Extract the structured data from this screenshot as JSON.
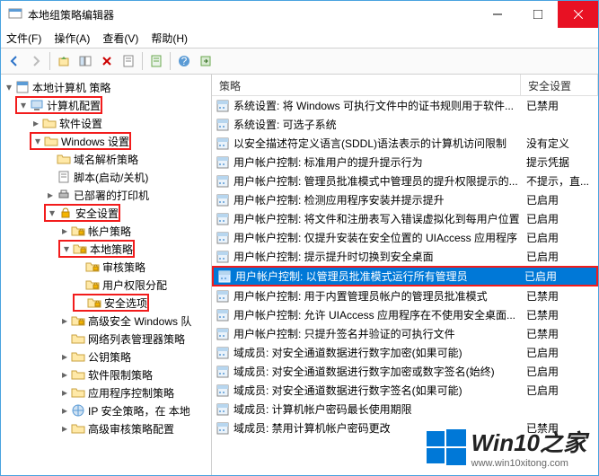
{
  "window": {
    "title": "本地组策略编辑器"
  },
  "menubar": [
    "文件(F)",
    "操作(A)",
    "查看(V)",
    "帮助(H)"
  ],
  "tree": {
    "root": "本地计算机 策略",
    "nodes": [
      {
        "indent": 0,
        "arrow": "▾",
        "label": "计算机配置",
        "hl": true,
        "icon": "computer"
      },
      {
        "indent": 1,
        "arrow": "▸",
        "label": "软件设置",
        "icon": "folder"
      },
      {
        "indent": 1,
        "arrow": "▾",
        "label": "Windows 设置",
        "hl": true,
        "icon": "folder"
      },
      {
        "indent": 2,
        "arrow": "",
        "label": "域名解析策略",
        "icon": "folder"
      },
      {
        "indent": 2,
        "arrow": "",
        "label": "脚本(启动/关机)",
        "icon": "script"
      },
      {
        "indent": 2,
        "arrow": "▸",
        "label": "已部署的打印机",
        "icon": "printer"
      },
      {
        "indent": 2,
        "arrow": "▾",
        "label": "安全设置",
        "hl": true,
        "icon": "lock"
      },
      {
        "indent": 3,
        "arrow": "▸",
        "label": "帐户策略",
        "icon": "folder-lock"
      },
      {
        "indent": 3,
        "arrow": "▾",
        "label": "本地策略",
        "hl": true,
        "icon": "folder-lock"
      },
      {
        "indent": 4,
        "arrow": "",
        "label": "审核策略",
        "icon": "folder-lock"
      },
      {
        "indent": 4,
        "arrow": "",
        "label": "用户权限分配",
        "icon": "folder-lock"
      },
      {
        "indent": 4,
        "arrow": "",
        "label": "安全选项",
        "hl": true,
        "icon": "folder-lock"
      },
      {
        "indent": 3,
        "arrow": "▸",
        "label": "高级安全 Windows 队",
        "icon": "folder-lock"
      },
      {
        "indent": 3,
        "arrow": "",
        "label": "网络列表管理器策略",
        "icon": "folder"
      },
      {
        "indent": 3,
        "arrow": "▸",
        "label": "公钥策略",
        "icon": "folder"
      },
      {
        "indent": 3,
        "arrow": "▸",
        "label": "软件限制策略",
        "icon": "folder"
      },
      {
        "indent": 3,
        "arrow": "▸",
        "label": "应用程序控制策略",
        "icon": "folder"
      },
      {
        "indent": 3,
        "arrow": "▸",
        "label": "IP 安全策略，在 本地",
        "icon": "ip"
      },
      {
        "indent": 3,
        "arrow": "▸",
        "label": "高级审核策略配置",
        "icon": "folder"
      }
    ]
  },
  "list": {
    "headers": {
      "policy": "策略",
      "setting": "安全设置"
    },
    "rows": [
      {
        "text": "系统设置: 将 Windows 可执行文件中的证书规则用于软件...",
        "setting": "已禁用"
      },
      {
        "text": "系统设置: 可选子系统",
        "setting": ""
      },
      {
        "text": "以安全描述符定义语言(SDDL)语法表示的计算机访问限制",
        "setting": "没有定义"
      },
      {
        "text": "用户帐户控制: 标准用户的提升提示行为",
        "setting": "提示凭据"
      },
      {
        "text": "用户帐户控制: 管理员批准模式中管理员的提升权限提示的...",
        "setting": "不提示，直..."
      },
      {
        "text": "用户帐户控制: 检测应用程序安装并提示提升",
        "setting": "已启用"
      },
      {
        "text": "用户帐户控制: 将文件和注册表写入错误虚拟化到每用户位置",
        "setting": "已启用"
      },
      {
        "text": "用户帐户控制: 仅提升安装在安全位置的 UIAccess 应用程序",
        "setting": "已启用"
      },
      {
        "text": "用户帐户控制: 提示提升时切换到安全桌面",
        "setting": "已启用"
      },
      {
        "text": "用户帐户控制: 以管理员批准模式运行所有管理员",
        "setting": "已启用",
        "selected": true,
        "hl": true
      },
      {
        "text": "用户帐户控制: 用于内置管理员帐户的管理员批准模式",
        "setting": "已禁用"
      },
      {
        "text": "用户帐户控制: 允许 UIAccess 应用程序在不使用安全桌面...",
        "setting": "已禁用"
      },
      {
        "text": "用户帐户控制: 只提升签名并验证的可执行文件",
        "setting": "已禁用"
      },
      {
        "text": "域成员: 对安全通道数据进行数字加密(如果可能)",
        "setting": "已启用"
      },
      {
        "text": "域成员: 对安全通道数据进行数字加密或数字签名(始终)",
        "setting": "已启用"
      },
      {
        "text": "域成员: 对安全通道数据进行数字签名(如果可能)",
        "setting": "已启用"
      },
      {
        "text": "域成员: 计算机帐户密码最长使用期限",
        "setting": ""
      },
      {
        "text": "域成员: 禁用计算机帐户密码更改",
        "setting": "已禁用"
      }
    ]
  },
  "watermark": {
    "brand": "Win10之家",
    "url": "www.win10xitong.com"
  }
}
